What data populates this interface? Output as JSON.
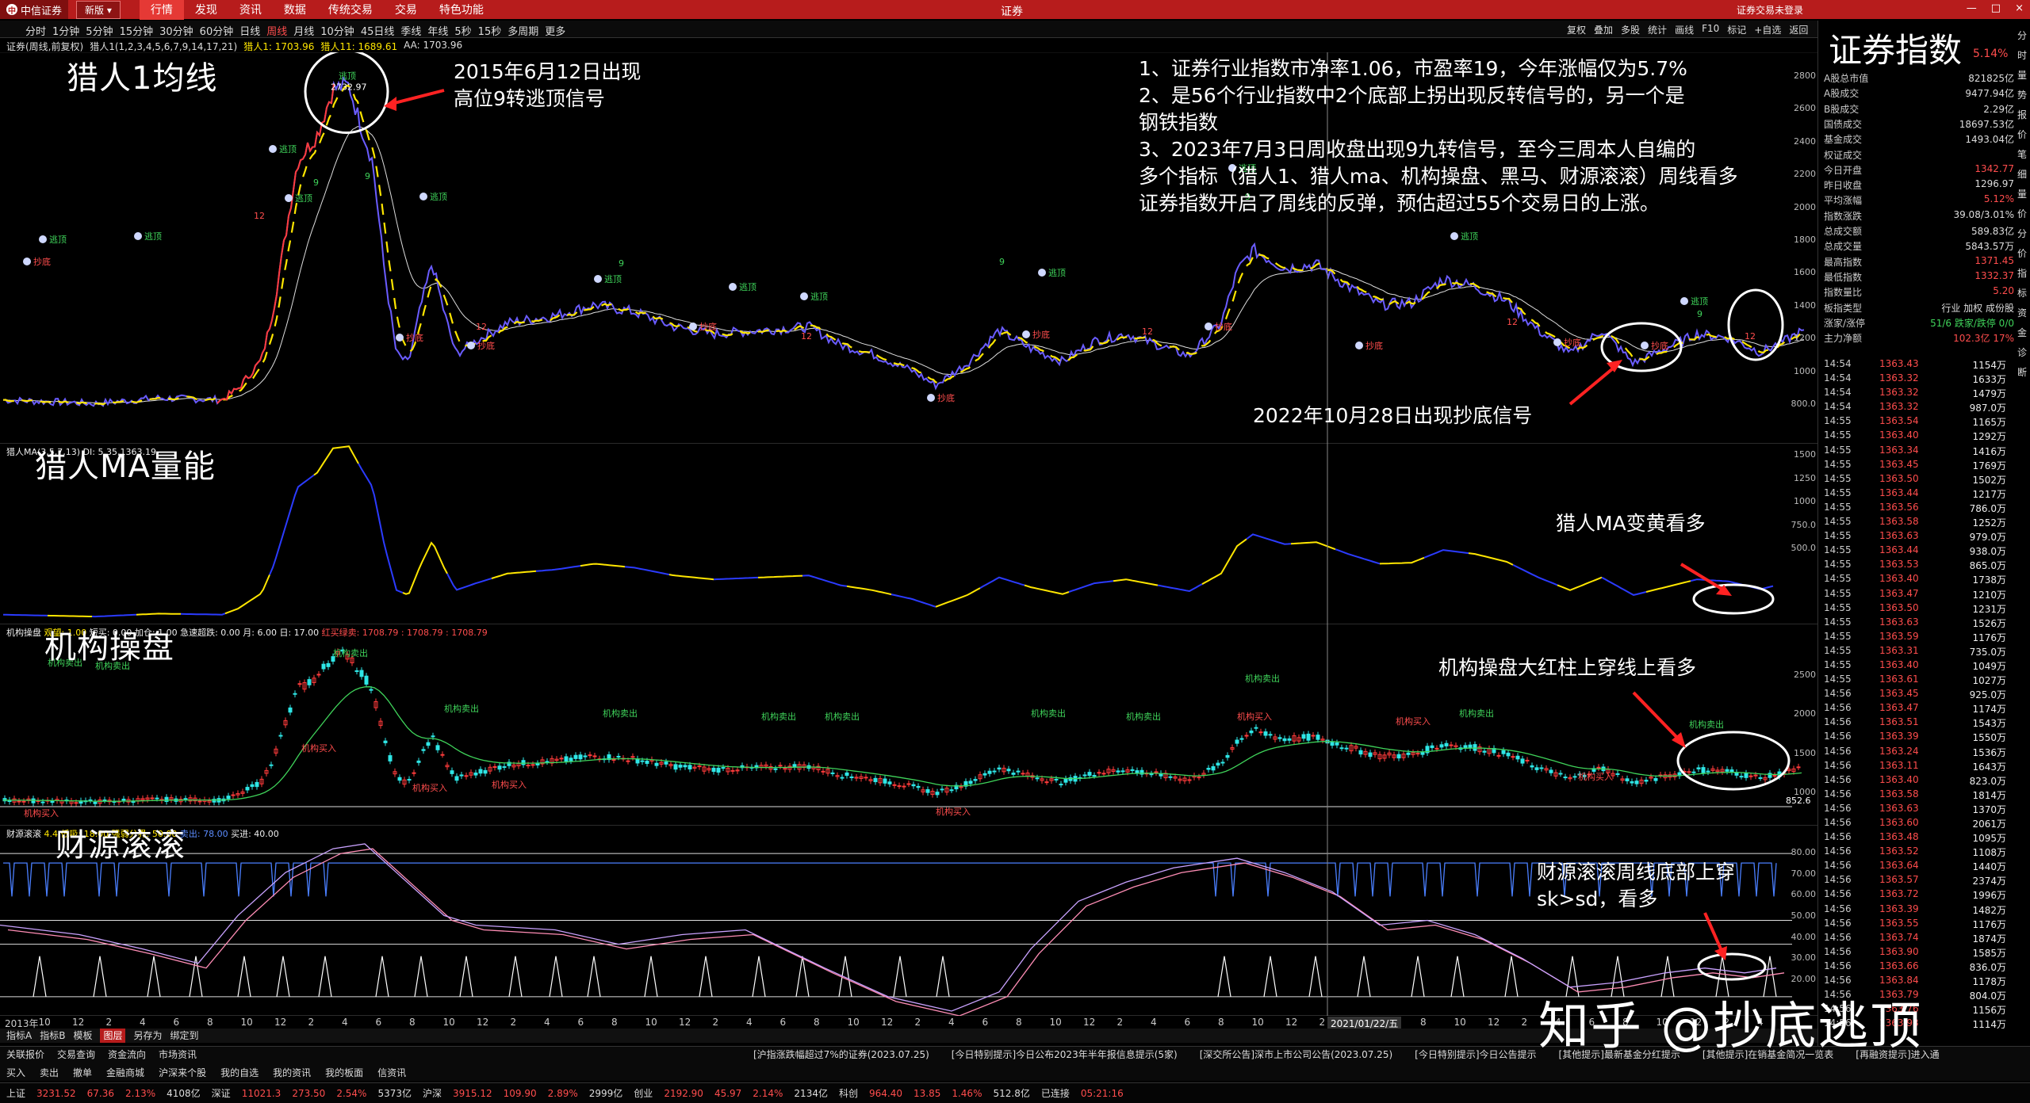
{
  "titlebar": {
    "logo": "中信证券",
    "version": "新版",
    "menu": [
      "行情",
      "发现",
      "资讯",
      "数据",
      "传统交易",
      "交易",
      "特色功能"
    ],
    "active_menu": "行情",
    "center_title": "证券",
    "right_text": "证券交易未登录",
    "win_buttons": [
      "—",
      "□",
      "×"
    ]
  },
  "toolbar": {
    "periods": [
      "分时",
      "1分钟",
      "5分钟",
      "15分钟",
      "30分钟",
      "60分钟",
      "日线",
      "周线",
      "月线",
      "10分钟",
      "45日线",
      "季线",
      "年线",
      "5秒",
      "15秒",
      "多周期",
      "更多"
    ],
    "selected": "周线",
    "tools": [
      "复权",
      "叠加",
      "多股",
      "统计",
      "画线",
      "F10",
      "标记",
      "+自选",
      "返回"
    ]
  },
  "infobar": {
    "name": "证券(周线,前复权)",
    "indicator": "猎人1(1,2,3,4,5,6,7,9,14,17,21)",
    "v1": "猎人1: 1703.96",
    "v2": "猎人11: 1689.61",
    "v3": "AA: 1703.96"
  },
  "panes": {
    "main_title": "猎人1均线",
    "ma_title": "猎人MA量能",
    "jg_title": "机构操盘",
    "cy_title": "财源滚滚"
  },
  "annotations": {
    "peak_note": "2015年6月12日出现\n高位9转逃顶信号",
    "summary": "1、证券行业指数市净率1.06，市盈率19，今年涨幅仅为5.7%\n2、是56个行业指数中2个底部上拐出现反转信号的，另一个是\n钢铁指数\n3、2023年7月3日周收盘出现9九转信号，至今三周本人自编的\n多个指标（猎人1、猎人ma、机构操盘、黑马、财源滚滚）周线看多\n证券指数开启了周线的反弹，预估超过55个交易日的上涨。",
    "bottom_signal": "2022年10月28日出现抄底信号",
    "ma_note": "猎人MA变黄看多",
    "jg_note": "机构操盘大红柱上穿线上看多",
    "cy_note": "财源滚滚周线底部上穿\nsk>sd，看多",
    "peak_value": "2732.97",
    "low_value": "852.6",
    "date_cursor": "2021/01/22/五"
  },
  "sub_headers": {
    "ma": "猎人MA(3,5,7,13) DI: 5.35,1363.19",
    "jg_a": "机构操盘",
    "jg_b": "观望: 1.00",
    "jg_c": "短买: 0.00  加仓: 1.00  急速超跌: 0.00  月: 6.00  日: 17.00",
    "jg_d": "红买绿卖: 1708.79 : 1708.79 : 1708.79",
    "cy_a": "财源滚滚",
    "cy_b": "4.4  低吸: 18.00  强弱分界: 50.00",
    "cy_c": "卖出: 78.00",
    "cy_d": "买进: 40.00"
  },
  "axes": {
    "main_y": [
      "2800",
      "2600",
      "2400",
      "2200",
      "2000",
      "1800",
      "1600",
      "1400",
      "1200",
      "1000",
      "800.0"
    ],
    "ma_y": [
      "1500",
      "1250",
      "1000",
      "750.0",
      "500.0"
    ],
    "jg_y": [
      "2500",
      "2000",
      "1500",
      "1000"
    ],
    "cy_y": [
      "80.00",
      "70.00",
      "60.00",
      "50.00",
      "40.00",
      "30.00",
      "20.00"
    ],
    "x_labels": [
      "2013年",
      "10",
      "12",
      "2",
      "4",
      "6",
      "8",
      "10",
      "12",
      "2",
      "4",
      "6",
      "8",
      "10",
      "12",
      "2",
      "4",
      "6",
      "8",
      "10",
      "12",
      "2",
      "4",
      "6",
      "8",
      "10",
      "12",
      "2",
      "4",
      "6",
      "8",
      "10",
      "12",
      "2",
      "4",
      "6",
      "8",
      "10",
      "12",
      "2",
      "4",
      "6",
      "8",
      "10",
      "12",
      "2",
      "4",
      "6",
      "8",
      "10",
      "12",
      "2",
      "4"
    ]
  },
  "signals": {
    "escape": "逃顶",
    "bottom": "抄底",
    "jg_buy": "机构买入",
    "jg_sell": "机构卖出",
    "nine": "9",
    "twelve": "12"
  },
  "rpanel": {
    "title": "证券指数",
    "pct": "5.14%",
    "stats": [
      [
        "A股总市值",
        "821825亿",
        ""
      ],
      [
        "A股成交",
        "9477.94亿",
        ""
      ],
      [
        "B股成交",
        "2.29亿",
        ""
      ],
      [
        "国债成交",
        "18697.53亿",
        ""
      ],
      [
        "基金成交",
        "1493.04亿",
        ""
      ],
      [
        "权证成交",
        "",
        ""
      ],
      [
        "今日开盘",
        "1342.77",
        "red"
      ],
      [
        "昨日收盘",
        "1296.97",
        ""
      ],
      [
        "平均涨幅",
        "5.12%",
        "red"
      ],
      [
        "指数涨跌",
        "39.08/3.01%",
        ""
      ],
      [
        "总成交额",
        "589.83亿",
        ""
      ],
      [
        "总成交量",
        "5843.57万",
        ""
      ],
      [
        "最高指数",
        "1371.45",
        "red"
      ],
      [
        "最低指数",
        "1332.37",
        "red"
      ],
      [
        "指数量比",
        "5.20",
        "red"
      ],
      [
        "板指类型",
        "行业 加权 成份股",
        ""
      ],
      [
        "涨家/涨停",
        "51/6   跌家/跌停  0/0",
        "grn"
      ],
      [
        "主力净额",
        "102.3亿  17%",
        "red"
      ]
    ],
    "ticks": [
      [
        "14:54",
        "1363.43",
        "1154万"
      ],
      [
        "14:54",
        "1363.32",
        "1633万"
      ],
      [
        "14:54",
        "1363.32",
        "1479万"
      ],
      [
        "14:54",
        "1363.32",
        "987.0万"
      ],
      [
        "14:55",
        "1363.54",
        "1165万"
      ],
      [
        "14:55",
        "1363.40",
        "1292万"
      ],
      [
        "14:55",
        "1363.34",
        "1416万"
      ],
      [
        "14:55",
        "1363.45",
        "1769万"
      ],
      [
        "14:55",
        "1363.50",
        "1502万"
      ],
      [
        "14:55",
        "1363.44",
        "1217万"
      ],
      [
        "14:55",
        "1363.56",
        "786.0万"
      ],
      [
        "14:55",
        "1363.58",
        "1252万"
      ],
      [
        "14:55",
        "1363.63",
        "979.0万"
      ],
      [
        "14:55",
        "1363.44",
        "938.0万"
      ],
      [
        "14:55",
        "1363.53",
        "865.0万"
      ],
      [
        "14:55",
        "1363.40",
        "1738万"
      ],
      [
        "14:55",
        "1363.47",
        "1210万"
      ],
      [
        "14:55",
        "1363.50",
        "1231万"
      ],
      [
        "14:55",
        "1363.63",
        "1526万"
      ],
      [
        "14:55",
        "1363.59",
        "1176万"
      ],
      [
        "14:55",
        "1363.31",
        "735.0万"
      ],
      [
        "14:55",
        "1363.40",
        "1049万"
      ],
      [
        "14:55",
        "1363.61",
        "1027万"
      ],
      [
        "14:56",
        "1363.45",
        "925.0万"
      ],
      [
        "14:56",
        "1363.47",
        "1174万"
      ],
      [
        "14:56",
        "1363.51",
        "1543万"
      ],
      [
        "14:56",
        "1363.39",
        "1550万"
      ],
      [
        "14:56",
        "1363.24",
        "1536万"
      ],
      [
        "14:56",
        "1363.11",
        "1643万"
      ],
      [
        "14:56",
        "1363.40",
        "823.0万"
      ],
      [
        "14:56",
        "1363.58",
        "1814万"
      ],
      [
        "14:56",
        "1363.63",
        "1370万"
      ],
      [
        "14:56",
        "1363.60",
        "2061万"
      ],
      [
        "14:56",
        "1363.48",
        "1095万"
      ],
      [
        "14:56",
        "1363.52",
        "1108万"
      ],
      [
        "14:56",
        "1363.64",
        "1440万"
      ],
      [
        "14:56",
        "1363.57",
        "2374万"
      ],
      [
        "14:56",
        "1363.72",
        "1996万"
      ],
      [
        "14:56",
        "1363.39",
        "1482万"
      ],
      [
        "14:56",
        "1363.55",
        "1176万"
      ],
      [
        "14:56",
        "1363.74",
        "1874万"
      ],
      [
        "14:56",
        "1363.90",
        "1585万"
      ],
      [
        "14:56",
        "1363.66",
        "836.0万"
      ],
      [
        "14:56",
        "1363.84",
        "1178万"
      ],
      [
        "14:56",
        "1363.79",
        "804.0万"
      ],
      [
        "14:56",
        "1363.76",
        "1156万"
      ],
      [
        "14:56",
        "1363.93",
        "1114万"
      ]
    ],
    "sidebar": [
      "分",
      "时",
      "量",
      "势",
      "报",
      "价",
      "笔",
      "细",
      "量",
      "价",
      "分",
      "价",
      "指",
      "标",
      "资",
      "金",
      "诊",
      "断"
    ]
  },
  "tabs": [
    "指标A",
    "指标B",
    "模板",
    "图层",
    "另存为",
    "绑定到"
  ],
  "tab_selected": "图层",
  "newsbar": {
    "left": [
      "关联报价",
      "交易查询",
      "资金流向",
      "市场资讯"
    ],
    "buttons": [
      "买入",
      "卖出",
      "撤单",
      "金融商城",
      "沪深来个股",
      "我的自选",
      "我的资讯",
      "我的板面",
      "信资讯"
    ],
    "news": [
      "[沪指涨跌幅超过7%的证券(2023.07.25)",
      "[今日特别提示]今日公布2023年半年报信息提示(5家)",
      "[深交所公告]深市上市公司公告(2023.07.25)",
      "[今日特别提示]今日公告提示",
      "[其他提示]最新基金分红提示",
      "[其他提示]在销基金简况一览表",
      "[再融资提示]进入通"
    ]
  },
  "statusbar": [
    "上证",
    "3231.52",
    "67.36",
    "2.13%",
    "4108亿",
    "深证",
    "11021.3",
    "273.50",
    "2.54%",
    "5373亿",
    "沪深",
    "3915.12",
    "109.90",
    "2.89%",
    "2999亿",
    "创业",
    "2192.90",
    "45.97",
    "2.14%",
    "2134亿",
    "科创",
    "964.40",
    "13.85",
    "1.46%",
    "512.8亿",
    "已连接",
    "05:21:16"
  ],
  "watermark": "知乎 @抄底逃顶"
}
